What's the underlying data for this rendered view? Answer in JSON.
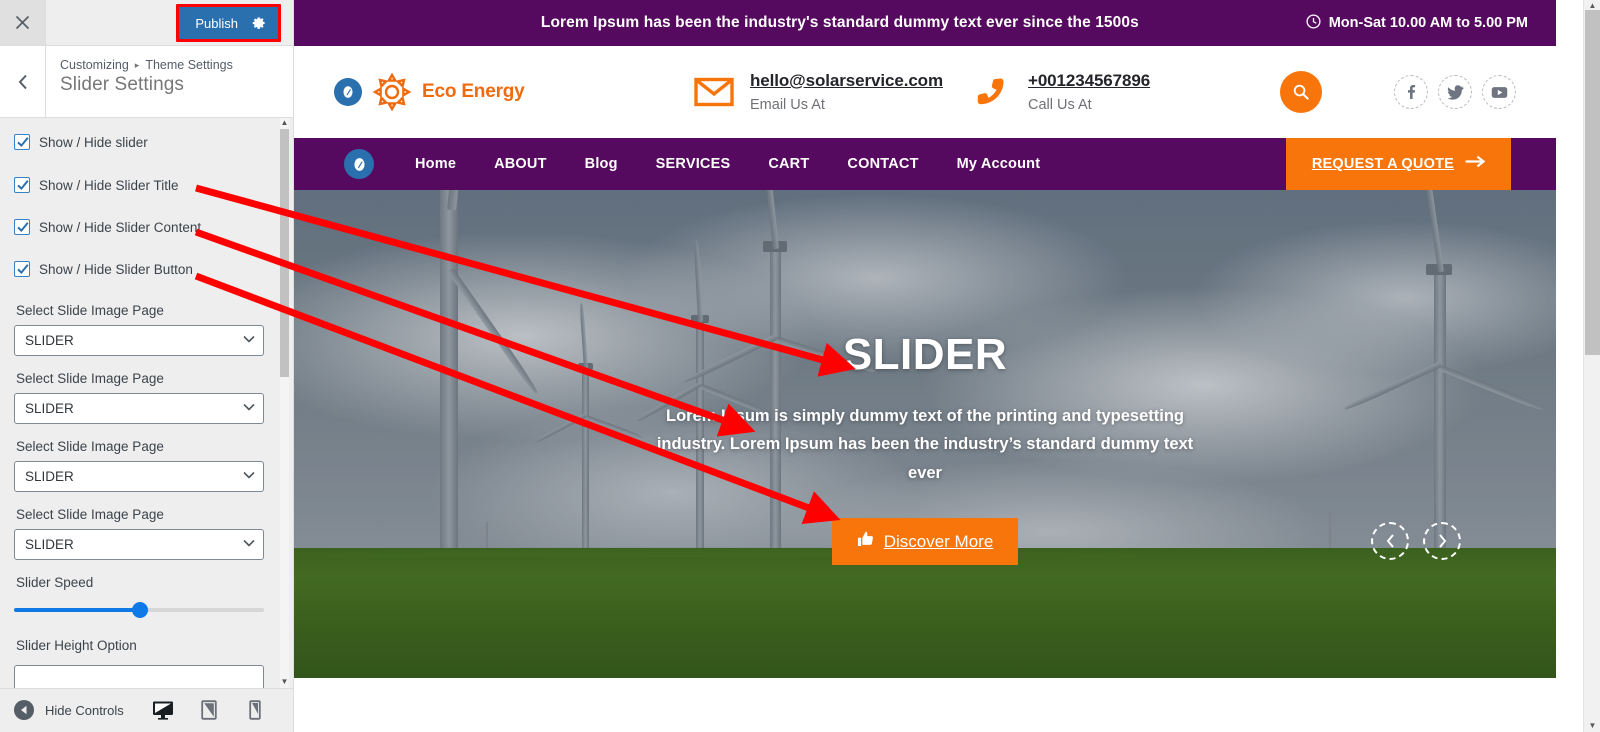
{
  "customizer": {
    "close_icon": "close-icon",
    "publish_label": "Publish",
    "gear_icon": "gear-icon",
    "back_icon": "chevron-left-icon",
    "breadcrumb_root": "Customizing",
    "breadcrumb_sep": "▸",
    "breadcrumb_parent": "Theme Settings",
    "panel_title": "Slider Settings",
    "checkboxes": [
      {
        "label": "Show / Hide slider",
        "checked": true
      },
      {
        "label": "Show / Hide Slider Title",
        "checked": true
      },
      {
        "label": "Show / Hide Slider Content",
        "checked": true
      },
      {
        "label": "Show / Hide Slider Button",
        "checked": true
      }
    ],
    "selects": [
      {
        "label": "Select Slide Image Page",
        "value": "SLIDER"
      },
      {
        "label": "Select Slide Image Page",
        "value": "SLIDER"
      },
      {
        "label": "Select Slide Image Page",
        "value": "SLIDER"
      },
      {
        "label": "Select Slide Image Page",
        "value": "SLIDER"
      }
    ],
    "slider_speed_label": "Slider Speed",
    "slider_height_label": "Slider Height Option",
    "footer": {
      "hide_controls_label": "Hide Controls",
      "devices": [
        {
          "name": "desktop",
          "active": true
        },
        {
          "name": "tablet",
          "active": false
        },
        {
          "name": "mobile",
          "active": false
        }
      ]
    },
    "accent_blue": "#2a6fae",
    "highlight_red": "#ff0000"
  },
  "site": {
    "topbar": {
      "message": "Lorem Ipsum has been the industry's standard dummy text ever since the 1500s",
      "clock_icon": "clock-icon",
      "hours": "Mon-Sat 10.00 AM to 5.00 PM"
    },
    "header": {
      "logo_badge_icon": "pencil-edit-icon",
      "logo_sun_icon": "sun-icon",
      "logo_text": "Eco Energy",
      "email": {
        "icon": "envelope-icon",
        "value": "hello@solarservice.com",
        "caption": "Email Us At"
      },
      "phone": {
        "icon": "phone-icon",
        "value": "+001234567896",
        "caption": "Call Us At"
      },
      "search_icon": "search-icon",
      "socials": [
        {
          "name": "facebook-icon",
          "glyph": "f"
        },
        {
          "name": "twitter-icon",
          "glyph": "t"
        },
        {
          "name": "youtube-icon",
          "glyph": "y"
        }
      ]
    },
    "nav": {
      "badge_icon": "pencil-edit-icon",
      "links": [
        "Home",
        "ABOUT",
        "Blog",
        "SERVICES",
        "CART",
        "CONTACT",
        "My Account"
      ],
      "quote_label": "REQUEST A QUOTE",
      "quote_icon": "arrow-right-icon"
    },
    "hero": {
      "title": "SLIDER",
      "description": "Lorem Ipsum is simply dummy text of the printing and typesetting industry. Lorem Ipsum has been the industry’s standard dummy text ever",
      "button_label": "Discover More",
      "button_icon": "thumbs-up-icon",
      "prev_icon": "chevron-left-icon",
      "next_icon": "chevron-right-icon"
    },
    "colors": {
      "purple": "#560a5f",
      "orange": "#f8750b",
      "blue": "#2a6fae"
    }
  }
}
